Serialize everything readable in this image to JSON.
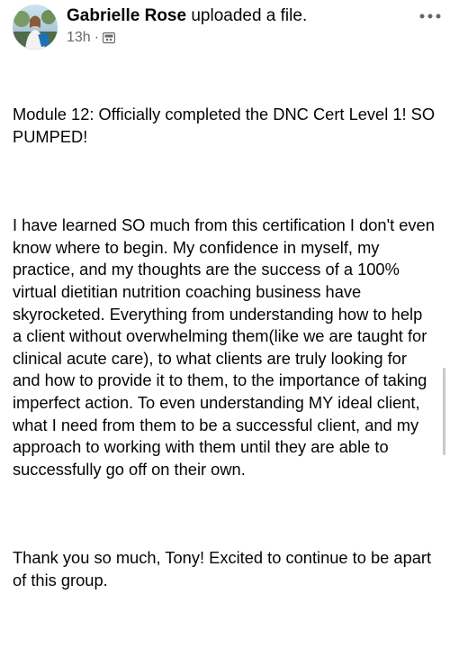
{
  "post": {
    "author": "Gabrielle Rose",
    "action": "uploaded a file.",
    "timestamp": "13h",
    "separator": "·",
    "audience_icon": "group-icon",
    "more_icon": "more-options-icon",
    "paragraphs": [
      "Module 12: Officially completed the DNC Cert Level 1! SO PUMPED!",
      "I have learned SO much from this certification I don't even know where to begin. My confidence in myself, my practice, and my thoughts are the success of a 100% virtual dietitian nutrition coaching business have skyrocketed. Everything from understanding how to help a client without overwhelming them(like we are taught for clinical acute care), to what clients are truly looking for and how to provide it to them, to the importance of taking imperfect action. To even understanding MY ideal client, what I need from them to be a successful client, and my approach to working with them until they are able to successfully go off on their own.",
      "Thank you so much, Tony! Excited to continue to be apart of this group."
    ]
  },
  "colors": {
    "text": "#050505",
    "secondary_text": "#65676b",
    "scrollbar": "#c9c9cb"
  }
}
